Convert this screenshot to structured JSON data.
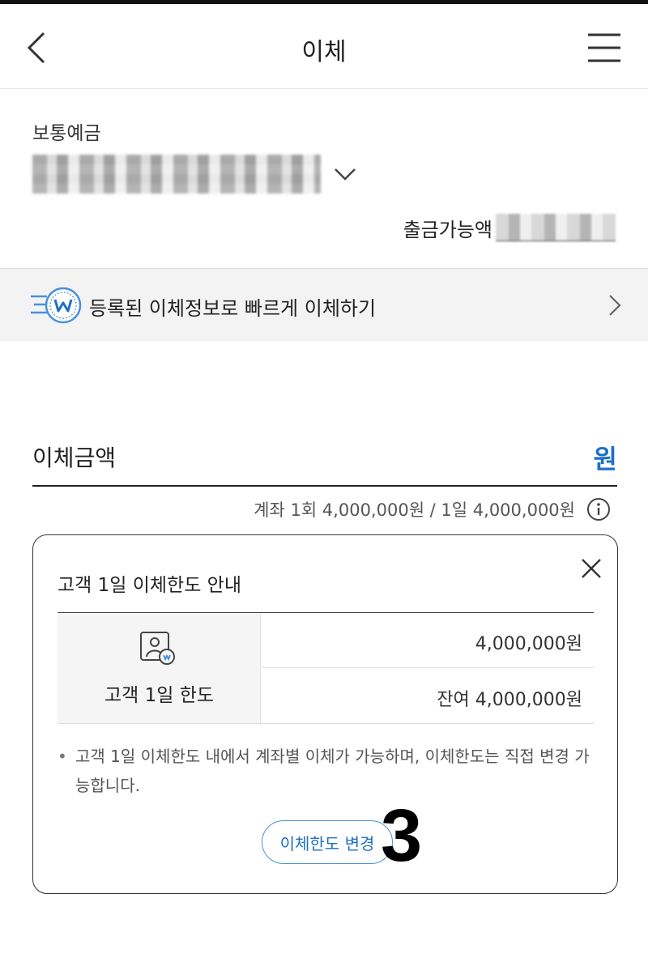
{
  "header": {
    "title": "이체",
    "back_icon": "chevron-left-icon",
    "menu_icon": "hamburger-menu-icon"
  },
  "account": {
    "type": "보통예금",
    "available_label": "출금가능액",
    "available_suffix": "원"
  },
  "quick_transfer": {
    "label": "등록된 이체정보로 빠르게 이체하기"
  },
  "amount": {
    "label": "이체금액",
    "unit": "원"
  },
  "limit_info": {
    "text": "계좌 1회 4,000,000원 / 1일 4,000,000원"
  },
  "popup": {
    "title": "고객 1일 이체한도 안내",
    "row_label": "고객 1일 한도",
    "limit_value": "4,000,000원",
    "remaining_value": "잔여 4,000,000원",
    "note": "고객 1일 이체한도 내에서 계좌별 이체가 가능하며, 이체한도는 직접 변경 가능합니다.",
    "change_button": "이체한도 변경"
  },
  "annotation": {
    "step_number": "3"
  },
  "colors": {
    "accent_blue": "#1e6fc7",
    "button_border": "#4a90d9",
    "quick_bg": "#f3f3f3"
  }
}
